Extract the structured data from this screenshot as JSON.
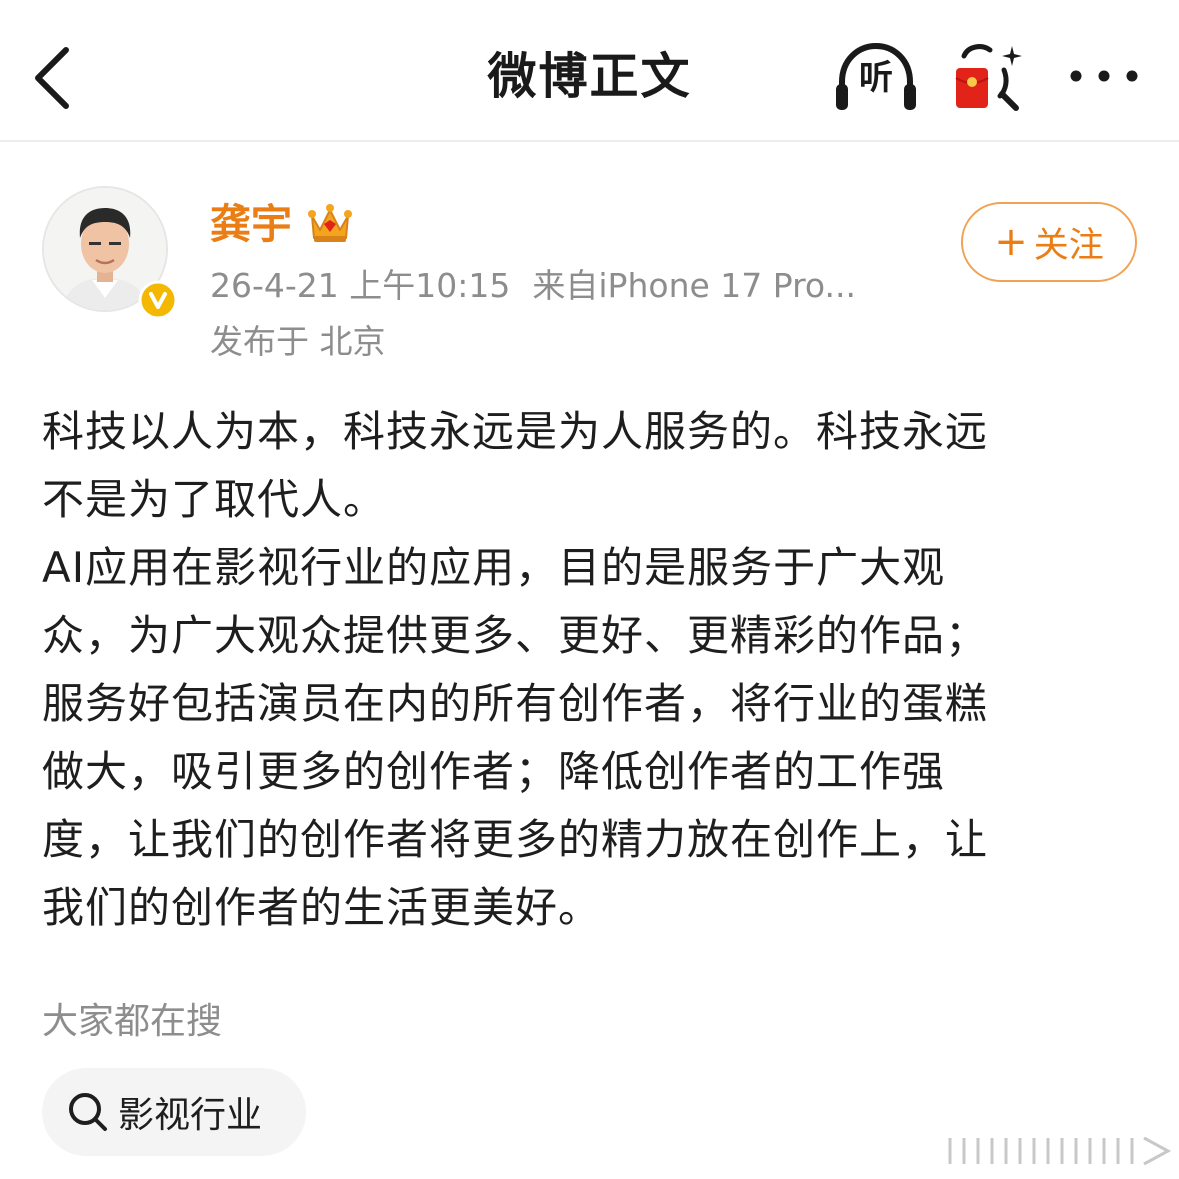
{
  "nav": {
    "title": "微博正文",
    "listen_label": "听"
  },
  "author": {
    "name": "龚宇",
    "time": "26-4-21 上午10:15",
    "source": "来自iPhone 17 Pro...",
    "location": "发布于 北京",
    "follow_label": "关注",
    "follow_plus": "+"
  },
  "post": {
    "lines": [
      "科技以人为本，科技永远是为人服务的。科技永远",
      "不是为了取代人。",
      "AI应用在影视行业的应用，目的是服务于广大观",
      "众，为广大观众提供更多、更好、更精彩的作品；",
      "服务好包括演员在内的所有创作者，将行业的蛋糕",
      "做大，吸引更多的创作者；降低创作者的工作强",
      "度，让我们的创作者将更多的精力放在创作上，让",
      "我们的创作者的生活更美好。"
    ]
  },
  "hot_search": {
    "title": "大家都在搜",
    "chip": "影视行业"
  },
  "colors": {
    "accent_orange": "#ea7e15",
    "follow_border": "#f0a356",
    "meta_gray": "#8d8d8d",
    "badge_gold": "#f5b800",
    "chip_bg": "#f4f4f4",
    "red_packet": "#e2231a"
  },
  "icons": {
    "back": "chevron-left-icon",
    "listen": "headphones-icon",
    "red_packet": "red-packet-icon",
    "more": "more-dots-icon",
    "verified": "verified-badge-icon",
    "crown": "crown-icon",
    "search": "search-icon"
  }
}
